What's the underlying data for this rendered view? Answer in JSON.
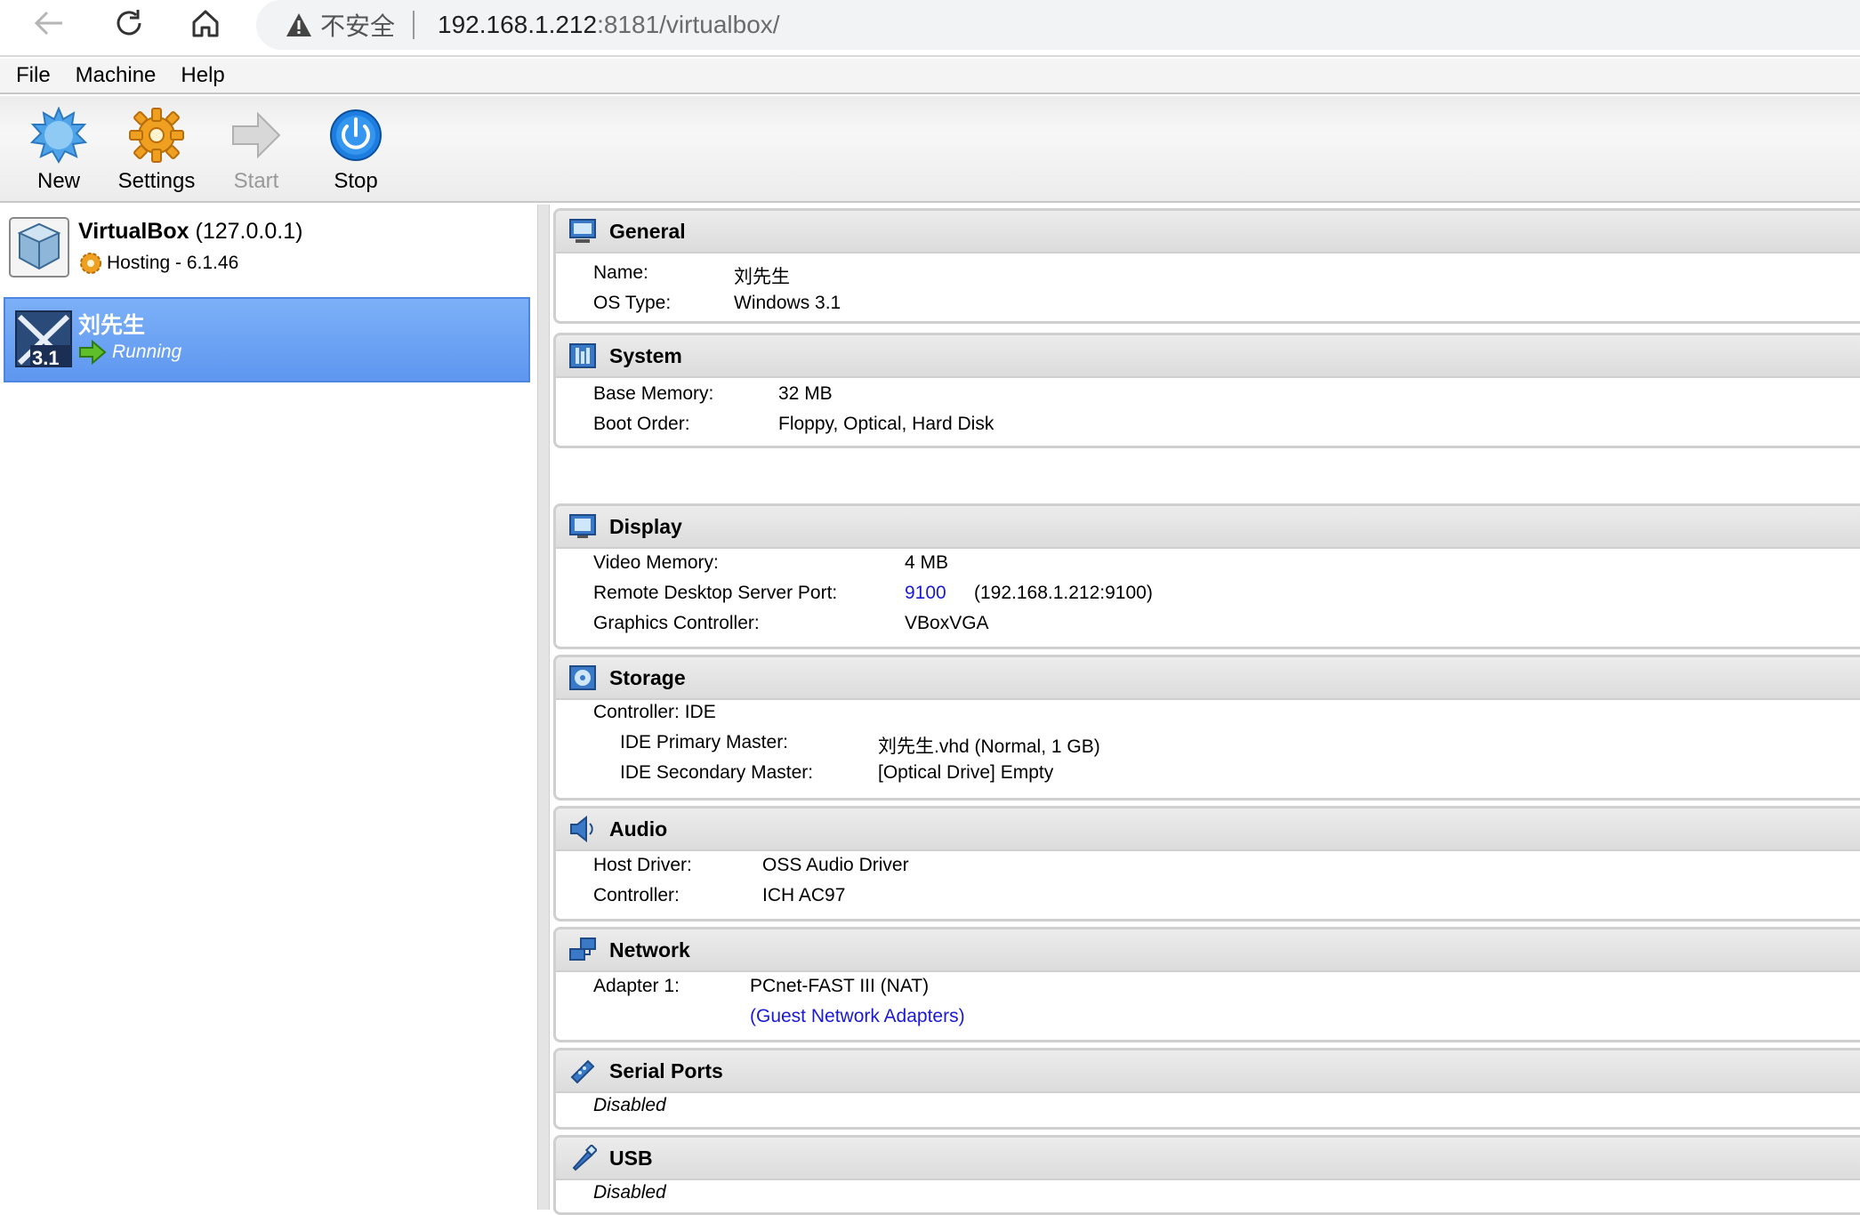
{
  "browser": {
    "security_label": "不安全",
    "url_host": "192.168.1.212",
    "url_path": ":8181/virtualbox/"
  },
  "menu": [
    "File",
    "Machine",
    "Help"
  ],
  "toolbar": {
    "new_label": "New",
    "settings_label": "Settings",
    "start_label": "Start",
    "stop_label": "Stop"
  },
  "vmlist": {
    "host_name": "VirtualBox",
    "host_addr": " (127.0.0.1)",
    "host_status": "Hosting - 6.1.46",
    "vm_name": "刘先生",
    "vm_os_badge": "3.1",
    "vm_state": "Running"
  },
  "details": {
    "general": {
      "title": "General",
      "name_label": "Name:",
      "name_value": "刘先生",
      "os_label": "OS Type:",
      "os_value": "Windows 3.1"
    },
    "system": {
      "title": "System",
      "mem_label": "Base Memory:",
      "mem_value": "32 MB",
      "boot_label": "Boot Order:",
      "boot_value": "Floppy, Optical, Hard Disk"
    },
    "display": {
      "title": "Display",
      "vmem_label": "Video Memory:",
      "vmem_value": "4 MB",
      "rdp_label": "Remote Desktop Server Port:",
      "rdp_port": "9100",
      "rdp_addr": "(192.168.1.212:9100)",
      "gfx_label": "Graphics Controller:",
      "gfx_value": "VBoxVGA"
    },
    "storage": {
      "title": "Storage",
      "controller": "Controller: IDE",
      "primary_label": "IDE Primary Master:",
      "primary_value": "刘先生.vhd (Normal, 1 GB)",
      "secondary_label": "IDE Secondary Master:",
      "secondary_value": "[Optical Drive] Empty"
    },
    "audio": {
      "title": "Audio",
      "host_label": "Host Driver:",
      "host_value": "OSS Audio Driver",
      "ctrl_label": "Controller:",
      "ctrl_value": "ICH AC97"
    },
    "network": {
      "title": "Network",
      "adapter_label": "Adapter 1:",
      "adapter_value": "PCnet-FAST III (NAT)",
      "guest_link": "(Guest Network Adapters)"
    },
    "serial": {
      "title": "Serial Ports",
      "value": "Disabled"
    },
    "usb": {
      "title": "USB",
      "value": "Disabled"
    }
  },
  "colors": {
    "selection": "#6aa3f4",
    "link": "#1a1ad6"
  }
}
